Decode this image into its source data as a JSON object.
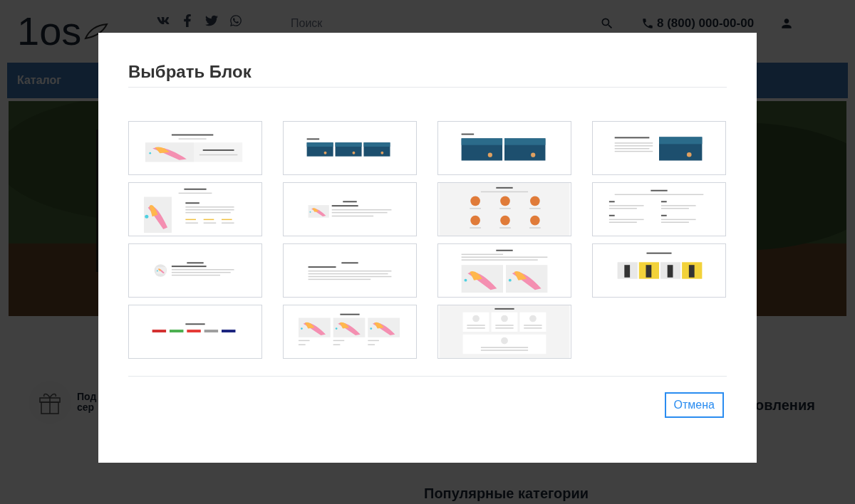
{
  "page": {
    "logo": "1os",
    "search": {
      "placeholder": "Поиск"
    },
    "phone": "8 (800) 000-00-00",
    "catalog": "Каталог",
    "promo_lines": [
      "Под",
      "сер"
    ],
    "heading_cut": "овления",
    "popular_heading": "Популярные категории"
  },
  "modal": {
    "title": "Выбрать Блок",
    "blocks": [
      {
        "kind": "hero"
      },
      {
        "kind": "gallery3"
      },
      {
        "kind": "gallery2"
      },
      {
        "kind": "text-image"
      },
      {
        "kind": "features"
      },
      {
        "kind": "media-text"
      },
      {
        "kind": "circles"
      },
      {
        "kind": "numbered"
      },
      {
        "kind": "avatar-text"
      },
      {
        "kind": "text"
      },
      {
        "kind": "two-images"
      },
      {
        "kind": "banners"
      },
      {
        "kind": "logos"
      },
      {
        "kind": "cards3"
      },
      {
        "kind": "avatar-cards"
      }
    ],
    "cancel": "Отмена"
  }
}
